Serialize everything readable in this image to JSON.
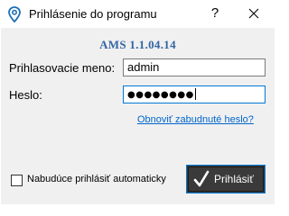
{
  "window": {
    "title": "Prihlásenie do programu",
    "help_label": "?",
    "close_icon": "close-icon",
    "app_icon": "map-pin-icon"
  },
  "form": {
    "version": "AMS 1.1.04.14",
    "username_label": "Prihlasovacie meno:",
    "username_value": "admin",
    "password_label": "Heslo:",
    "password_value": "●●●●●●●●",
    "forgot_link": "Obnoviť zabudnuté heslo?",
    "remember_label": "Nabudúce prihlásiť automaticky",
    "remember_checked": false,
    "login_label": "Prihlásiť",
    "login_icon": "checkmark-icon"
  },
  "colors": {
    "accent": "#0078d7",
    "version_text": "#3366a3",
    "link": "#0066cc",
    "button_bg": "#3a3a3a",
    "panel_bg": "#f0f0f0"
  }
}
